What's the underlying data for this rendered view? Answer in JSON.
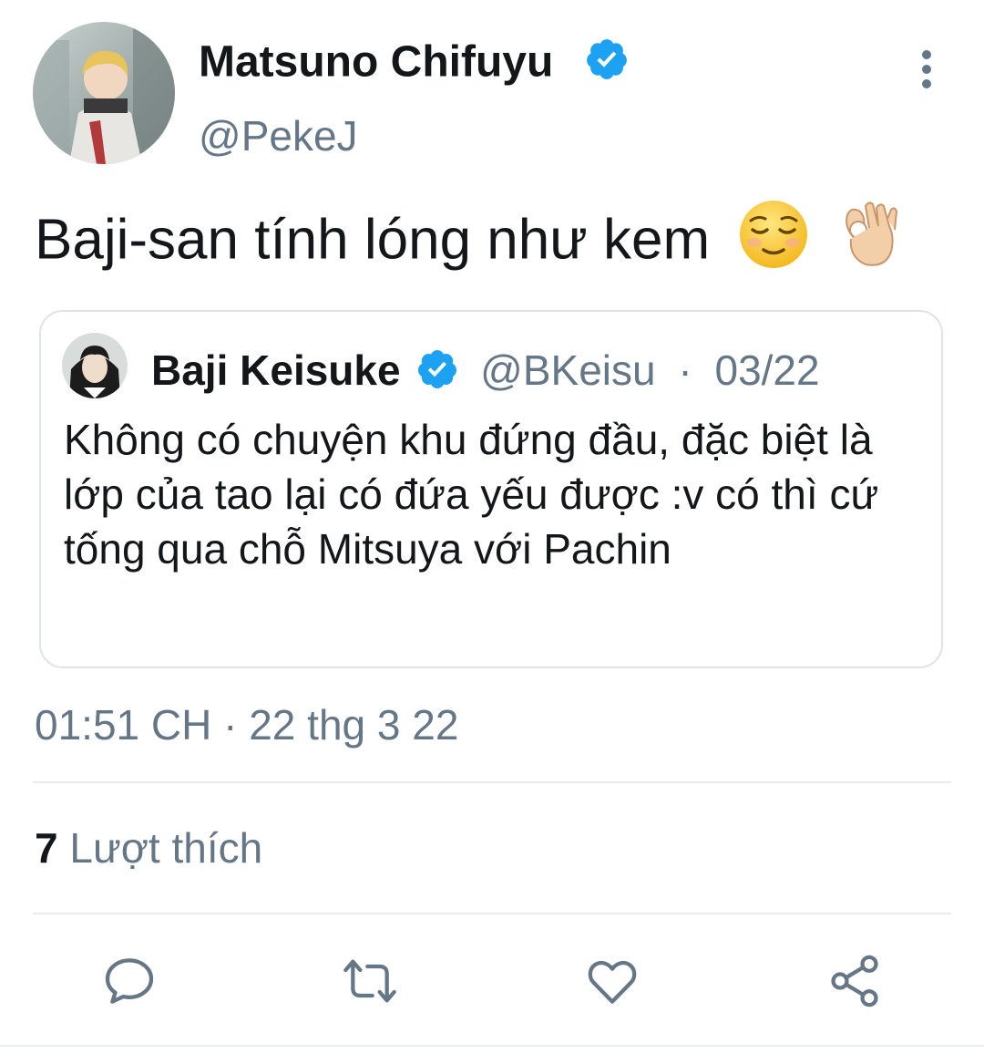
{
  "author": {
    "name": "Matsuno Chifuyu",
    "handle": "@PekeJ",
    "verified": true,
    "avatar": "anime-avatar-blonde-boy"
  },
  "tweet": {
    "text": "Baji-san tính lóng như kem",
    "emojis": [
      "relieved-face",
      "ok-hand-light-skin"
    ]
  },
  "quoted_tweet": {
    "name": "Baji Keisuke",
    "handle": "@BKeisu",
    "separator": "·",
    "date": "03/22",
    "verified": true,
    "avatar": "anime-avatar-dark-hair",
    "text": "Không có chuyện khu đứng đầu, đặc biệt là lớp của tao lại có đứa yếu được :v có thì cứ tống qua chỗ Mitsuya với Pachin"
  },
  "timestamp": "01:51 CH · 22 thg 3 22",
  "stats": {
    "likes_count": "7",
    "likes_label": "Lượt thích"
  },
  "actions": [
    "reply-icon",
    "retweet-icon",
    "like-icon",
    "share-icon"
  ],
  "colors": {
    "text": "#14171a",
    "secondary": "#657786",
    "verified": "#1da1f2",
    "border": "#dce4ea"
  }
}
